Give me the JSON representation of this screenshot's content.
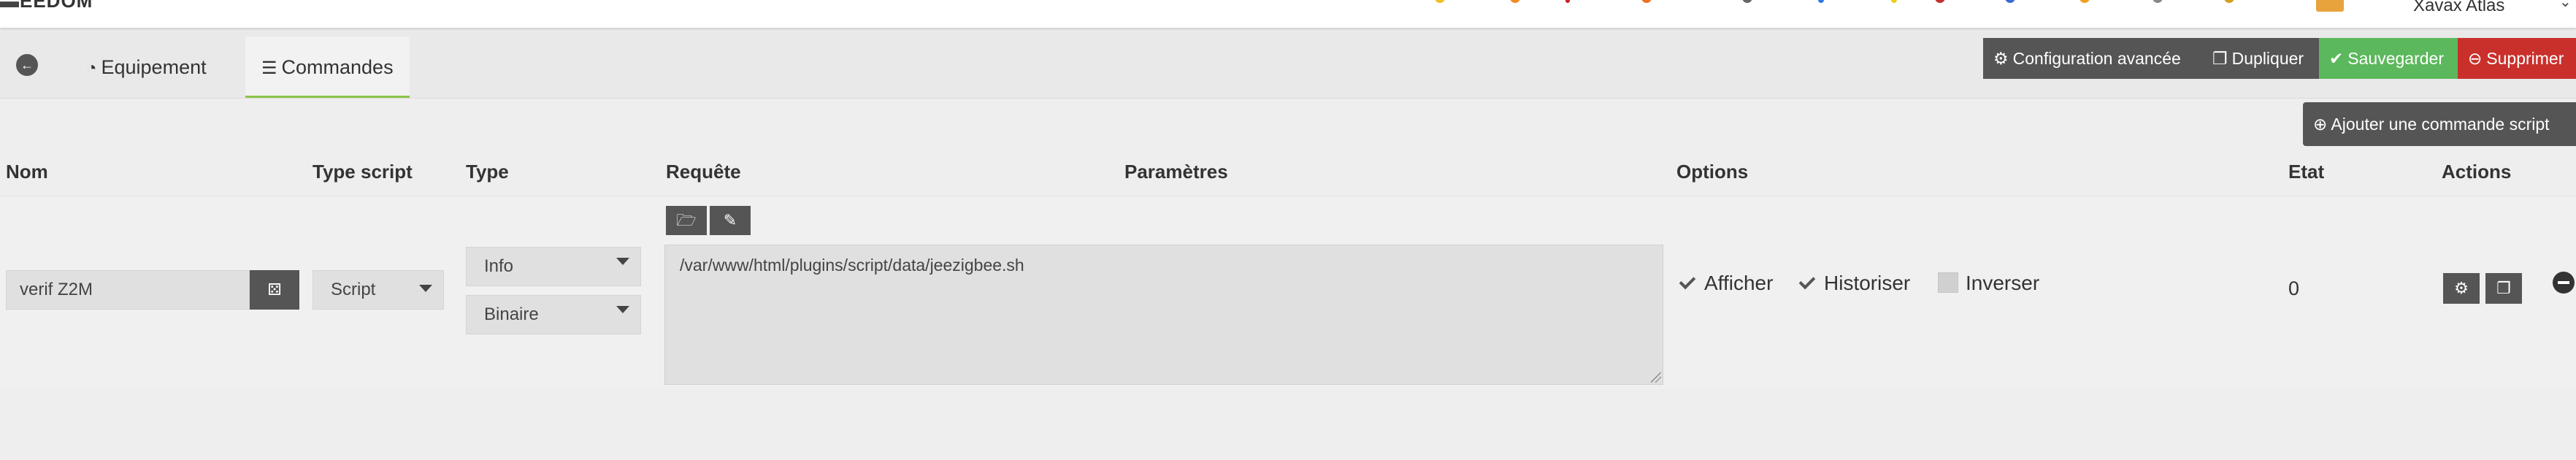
{
  "navbar": {
    "logo": "EEDOM",
    "user": "Xavax Atlas"
  },
  "tabs": {
    "back_icon": "arrow-left-circle-icon",
    "equipement": "Equipement",
    "commandes": "Commandes"
  },
  "actions": {
    "config": "Configuration avancée",
    "dupliquer": "Dupliquer",
    "sauvegarder": "Sauvegarder",
    "supprimer": "Supprimer",
    "add_command": "Ajouter une commande script"
  },
  "colors": {
    "dark": "#555555",
    "save": "#5cb85c",
    "delete": "#c9302c",
    "accent": "#8bc34a"
  },
  "table": {
    "headers": {
      "nom": "Nom",
      "type_script": "Type script",
      "type": "Type",
      "requete": "Requête",
      "parametres": "Paramètres",
      "options": "Options",
      "etat": "Etat",
      "actions": "Actions"
    },
    "rows": [
      {
        "nom": "verif Z2M",
        "type_script": "Script",
        "type": "Info",
        "subtype": "Binaire",
        "requete": "/var/www/html/plugins/script/data/jeezigbee.sh",
        "options": {
          "afficher": {
            "label": "Afficher",
            "checked": true
          },
          "historiser": {
            "label": "Historiser",
            "checked": true
          },
          "inverser": {
            "label": "Inverser",
            "checked": false
          }
        },
        "etat": "0"
      }
    ]
  }
}
